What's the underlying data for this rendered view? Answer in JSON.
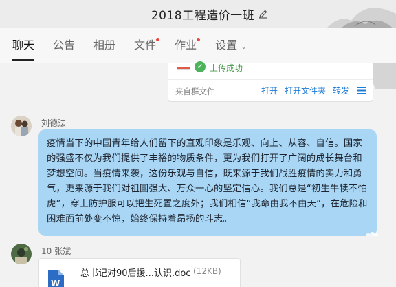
{
  "header": {
    "title": "2018工程造价一班"
  },
  "tabs": [
    {
      "label": "聊天",
      "active": true,
      "dot": false
    },
    {
      "label": "公告",
      "active": false,
      "dot": false
    },
    {
      "label": "相册",
      "active": false,
      "dot": false
    },
    {
      "label": "文件",
      "active": false,
      "dot": true
    },
    {
      "label": "作业",
      "active": false,
      "dot": true
    },
    {
      "label": "设置",
      "active": false,
      "dot": false
    }
  ],
  "file_card_top": {
    "status": "上传成功",
    "source": "来自群文件",
    "open": "打开",
    "open_folder": "打开文件夹",
    "forward": "转发"
  },
  "message1": {
    "sender": "刘德法",
    "text": "疫情当下的中国青年给人们留下的直观印象是乐观、向上、从容、自信。国家的强盛不仅为我们提供了丰裕的物质条件，更为我们打开了广阔的成长舞台和梦想空间。当疫情来袭，这份乐观与自信，既来源于我们战胜疫情的实力和勇气，更来源于我们对祖国强大、万众一心的坚定信心。我们总是“初生牛犊不怕虎”，穿上防护服可以把生死置之度外；我们相信“我命由我不由天”，在危险和困难面前处变不惊，始终保持着昂扬的斗志。"
  },
  "message2": {
    "sender": "10 张斌",
    "file_name": "总书记对90后援...认识.doc",
    "file_size": "(12KB)"
  },
  "colors": {
    "bubble": "#a8d6f4",
    "link": "#1e7bd6",
    "success": "#4cb35a",
    "notify_dot": "#e9443d"
  }
}
